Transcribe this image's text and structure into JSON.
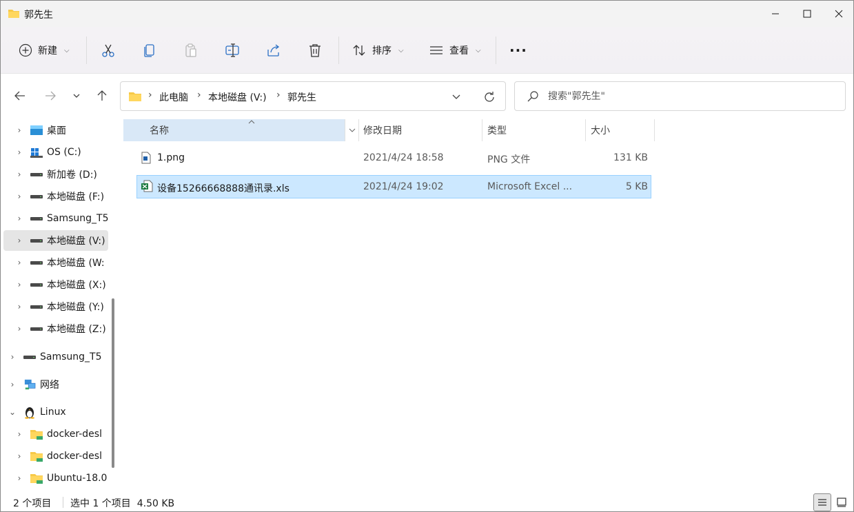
{
  "window": {
    "title": "郭先生"
  },
  "toolbar": {
    "new_label": "新建",
    "sort_label": "排序",
    "view_label": "查看",
    "more_label": "···"
  },
  "address": {
    "crumbs": [
      "此电脑",
      "本地磁盘 (V:)",
      "郭先生"
    ]
  },
  "search": {
    "placeholder": "搜索\"郭先生\""
  },
  "sidebar": {
    "items": [
      {
        "label": "桌面",
        "icon": "desktop-icon"
      },
      {
        "label": "OS (C:)",
        "icon": "windows-drive-icon"
      },
      {
        "label": "新加卷 (D:)",
        "icon": "drive-icon"
      },
      {
        "label": "本地磁盘 (F:)",
        "icon": "drive-icon"
      },
      {
        "label": "Samsung_T5",
        "icon": "drive-icon"
      },
      {
        "label": "本地磁盘 (V:)",
        "icon": "drive-icon"
      },
      {
        "label": "本地磁盘 (W:",
        "icon": "drive-icon"
      },
      {
        "label": "本地磁盘 (X:)",
        "icon": "drive-icon"
      },
      {
        "label": "本地磁盘 (Y:)",
        "icon": "drive-icon"
      },
      {
        "label": "本地磁盘 (Z:)",
        "icon": "drive-icon"
      },
      {
        "label": "Samsung_T5",
        "icon": "drive-icon"
      },
      {
        "label": "网络",
        "icon": "network-icon"
      },
      {
        "label": "Linux",
        "icon": "linux-penguin-icon"
      },
      {
        "label": "docker-desl",
        "icon": "folder-icon"
      },
      {
        "label": "docker-desl",
        "icon": "folder-icon"
      },
      {
        "label": "Ubuntu-18.0",
        "icon": "folder-icon"
      }
    ]
  },
  "columns": {
    "name": "名称",
    "modified": "修改日期",
    "type": "类型",
    "size": "大小"
  },
  "files": [
    {
      "name": "1.png",
      "modified": "2021/4/24 18:58",
      "type": "PNG 文件",
      "size": "131 KB",
      "icon": "image-file-icon"
    },
    {
      "name": "设备15266668888通讯录.xls",
      "modified": "2021/4/24 19:02",
      "type": "Microsoft Excel ...",
      "size": "5 KB",
      "icon": "excel-file-icon"
    }
  ],
  "status": {
    "count": "2 个项目",
    "selection": "选中 1 个项目  4.50 KB"
  },
  "colors": {
    "accent_selected": "#cce8ff",
    "folder_yellow": "#f7c948"
  }
}
